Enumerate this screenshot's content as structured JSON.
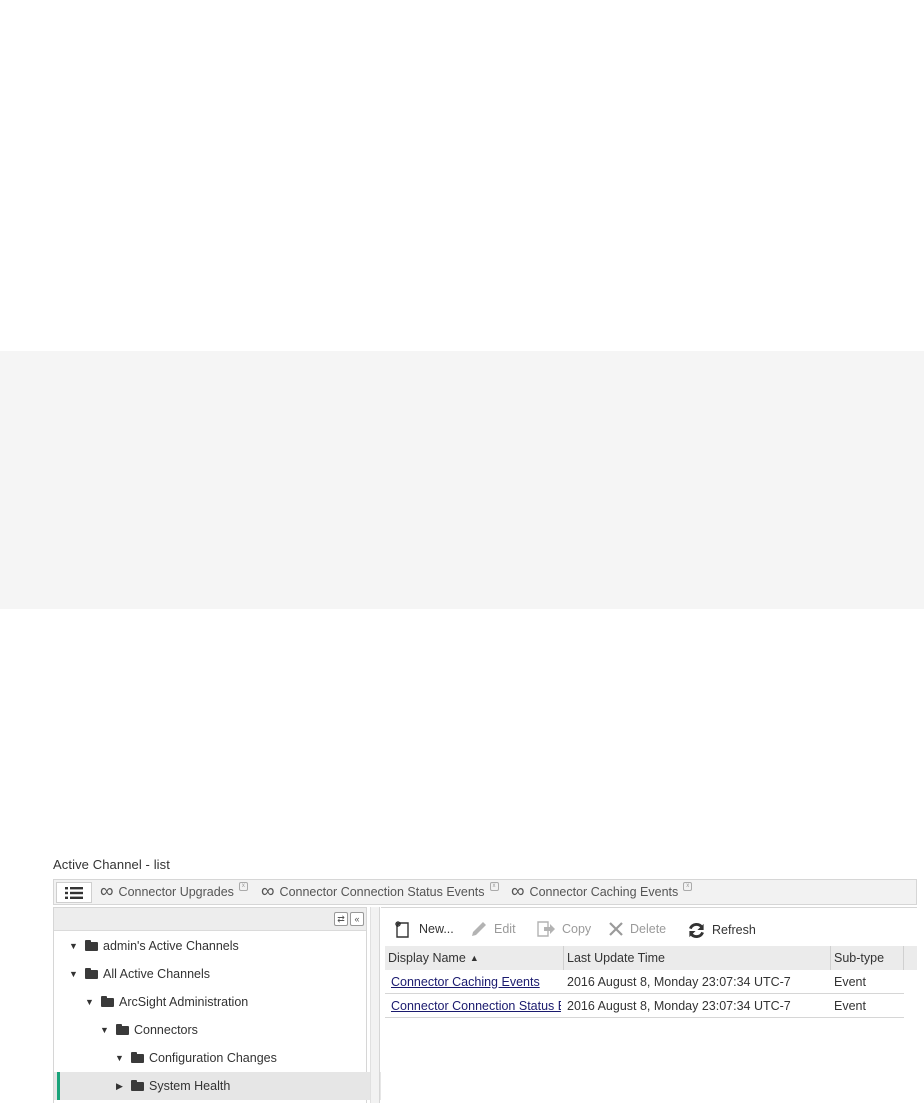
{
  "section_title": "Active Channel - list",
  "tabs": [
    {
      "label": "Connector Upgrades",
      "icon": "infinity-icon"
    },
    {
      "label": "Connector Connection Status Events",
      "icon": "infinity-icon"
    },
    {
      "label": "Connector Caching Events",
      "icon": "infinity-icon"
    }
  ],
  "tree": {
    "items": [
      {
        "label": "admin's Active Channels",
        "expanded": true,
        "level": 0
      },
      {
        "label": "All Active Channels",
        "expanded": true,
        "level": 0
      },
      {
        "label": "ArcSight Administration",
        "expanded": true,
        "level": 1
      },
      {
        "label": "Connectors",
        "expanded": true,
        "level": 2
      },
      {
        "label": "Configuration Changes",
        "expanded": true,
        "level": 3
      },
      {
        "label": "System Health",
        "expanded": false,
        "level": 3,
        "selected": true
      }
    ]
  },
  "toolbar": {
    "new_label": "New...",
    "edit_label": "Edit",
    "copy_label": "Copy",
    "delete_label": "Delete",
    "refresh_label": "Refresh"
  },
  "grid": {
    "columns": [
      "Display Name",
      "Last Update Time",
      "Sub-type"
    ],
    "sort_indicator": "▲",
    "rows": [
      {
        "name": "Connector Caching Events",
        "time": "2016 August 8, Monday 23:07:34 UTC-7",
        "subtype": "Event"
      },
      {
        "name": "Connector Connection Status E...",
        "time": "2016 August 8, Monday 23:07:34 UTC-7",
        "subtype": "Event"
      }
    ]
  },
  "colors": {
    "accent_selected": "#1aa37a",
    "link": "#1a1a6e"
  }
}
